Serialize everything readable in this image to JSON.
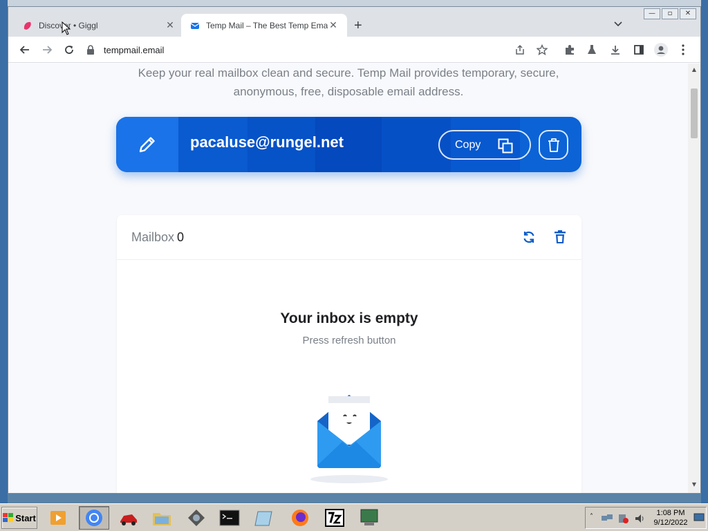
{
  "browser": {
    "tabs": [
      {
        "title": "Discover • Giggl",
        "active": false
      },
      {
        "title": "Temp Mail – The Best Temp Email",
        "active": true
      }
    ],
    "new_tab_symbol": "+",
    "close_symbol": "✕",
    "url": "tempmail.email"
  },
  "page": {
    "lead_line1": "Keep your real mailbox clean and secure. Temp Mail provides temporary, secure,",
    "lead_line2": "anonymous, free, disposable email address.",
    "email_address": "pacaluse@rungel.net",
    "copy_label": "Copy",
    "mailbox": {
      "label": "Mailbox",
      "count": "0",
      "empty_title": "Your inbox is empty",
      "empty_subtitle": "Press refresh button"
    }
  },
  "taskbar": {
    "start_label": "Start",
    "clock_time": "1:08 PM",
    "clock_date": "9/12/2022"
  },
  "colors": {
    "primary_blue": "#0b63d6",
    "accent_blue": "#1a73e8",
    "icon_blue": "#0b5cc9"
  }
}
